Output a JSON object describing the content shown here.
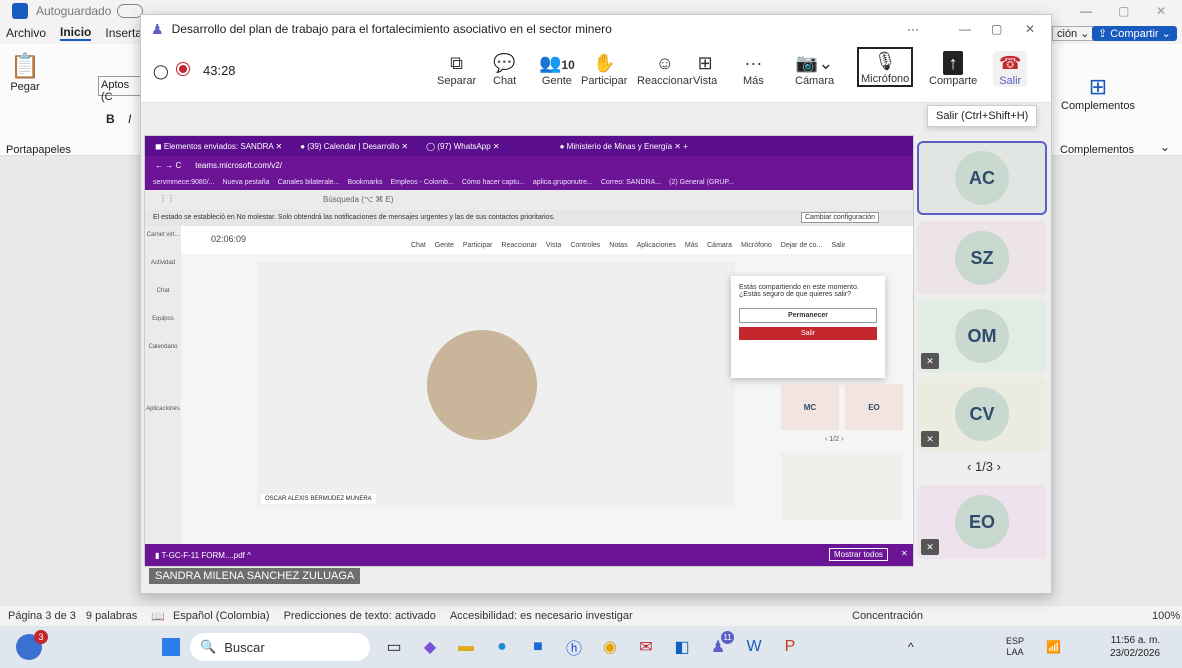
{
  "word": {
    "autosave": "Autoguardado",
    "menu": [
      "Archivo",
      "Inicio",
      "Inserta"
    ],
    "font_name": "Aptos (C",
    "paste_label": "Pegar",
    "clipboard_group": "Portapapeles",
    "edit_mode": "ción",
    "share_label": "Compartir",
    "addins": "Complementos",
    "addins_group": "Complementos",
    "status": {
      "page": "Página 3 de 3",
      "words": "9 palabras",
      "language": "Español (Colombia)",
      "predictions": "Predicciones de texto: activado",
      "accessibility": "Accesibilidad: es necesario investigar",
      "focus": "Concentración",
      "zoom": "100%"
    }
  },
  "teams": {
    "title": "Desarrollo del plan de trabajo para el fortalecimiento asociativo en el sector minero",
    "timer": "43:28",
    "people_count": "10",
    "toolbar": [
      "Separar",
      "Chat",
      "Gente",
      "Participar",
      "Reaccionar",
      "Vista",
      "Más",
      "Cámara",
      "Micrófono",
      "Comparte",
      "Salir"
    ],
    "tooltip": "Salir (Ctrl+Shift+H)",
    "presenter_name": "SANDRA MILENA SANCHEZ ZULUAGA",
    "participants": [
      "AC",
      "SZ",
      "OM",
      "CV",
      "EO"
    ],
    "page_indicator": "1/3"
  },
  "browser": {
    "tabs": [
      "Elementos enviados: SANDRA",
      "(39) Calendar | Desarrollo",
      "(97) WhatsApp",
      "Ministerio de Minas y Energía"
    ],
    "url": "teams.microsoft.com/v2/",
    "bookmarks": [
      "servmmece:9080/...",
      "Nueva pestaña",
      "Canales bilaterale...",
      "Bookmarks",
      "Empleos - Colomb...",
      "Cómo hacer captu...",
      "aplica.gruponutre...",
      "Correo: SANDRA...",
      "(2) General (GRUP..."
    ],
    "search_placeholder": "Búsqueda (⌥ ⌘ E)",
    "dnd_notice": "El estado se estableció en No molestar. Solo obtendrá las notificaciones de mensajes urgentes y las de sus contactos prioritarios.",
    "change_settings": "Cambiar configuración",
    "inner_timer": "02:06:09",
    "inner_people": "10",
    "inner_toolbar": [
      "Chat",
      "Gente",
      "Participar",
      "Reaccionar",
      "Vista",
      "Controles",
      "Notas",
      "Aplicaciones",
      "Más",
      "Cámara",
      "Micrófono",
      "Dejar de co...",
      "Salir"
    ],
    "left_rail": [
      "Carnet virt...",
      "Actividad",
      "Chat",
      "Equipos",
      "Calendario",
      "Aplicaciones"
    ],
    "activity_badge": "1",
    "chat_badge": "7",
    "speaker_name": "OSCAR ALEXIS BERMUDEZ MUNERA",
    "leave_prompt": "Estás compartiendo en este momento. ¿Estás seguro de que quieres salir?",
    "stay_button": "Permanecer",
    "leave_button": "Salir",
    "mini_tiles": [
      "MC",
      "EO"
    ],
    "mini_page": "1/2",
    "download_file": "T-GC-F-11 FORM....pdf",
    "show_all": "Mostrar todos"
  },
  "taskbar": {
    "search": "Buscar",
    "notif_badge": "3",
    "teams_badge": "11",
    "lang": "ESP",
    "lang2": "LAA",
    "time": "11:56 a. m.",
    "date": "23/02/2026"
  },
  "colors": {
    "purple": "#6b1596",
    "red": "#c4262e",
    "word_blue": "#185abd"
  }
}
